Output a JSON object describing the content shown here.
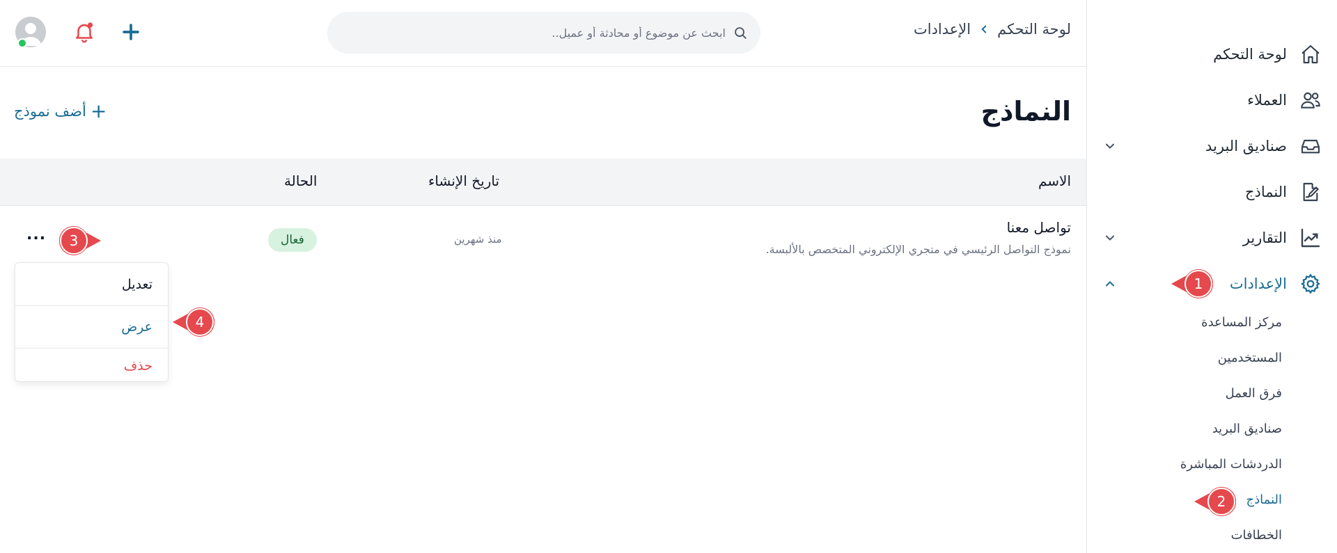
{
  "sidebar": {
    "items": [
      {
        "label": "لوحة التحكم",
        "icon": "home-icon"
      },
      {
        "label": "العملاء",
        "icon": "users-icon"
      },
      {
        "label": "صناديق البريد",
        "icon": "inbox-icon"
      },
      {
        "label": "النماذج",
        "icon": "form-edit-icon"
      },
      {
        "label": "التقارير",
        "icon": "chart-icon"
      },
      {
        "label": "الإعدادات",
        "icon": "gear-icon"
      }
    ],
    "settings_sub": [
      {
        "label": "مركز المساعدة"
      },
      {
        "label": "المستخدمين"
      },
      {
        "label": "فرق العمل"
      },
      {
        "label": "صناديق البريد"
      },
      {
        "label": "الدردشات المباشرة"
      },
      {
        "label": "النماذج"
      },
      {
        "label": "الخطافات"
      }
    ]
  },
  "header": {
    "breadcrumb": [
      "لوحة التحكم",
      "الإعدادات"
    ],
    "search_placeholder": "ابحث عن موضوع أو محادثة أو عميل.."
  },
  "page": {
    "title": "النماذج",
    "add_label": "أضف نموذج"
  },
  "table": {
    "headers": {
      "name": "الاسم",
      "created": "تاريخ الإنشاء",
      "status": "الحالة"
    },
    "row": {
      "title": "تواصل معنا",
      "description": "نموذج التواصل الرئيسي في متجري الإلكتروني المتخصص بالألبسة.",
      "created": "منذ شهرين",
      "status": "فعال",
      "more": "..."
    }
  },
  "menu": {
    "edit": "تعديل",
    "view": "عرض",
    "delete": "حذف"
  },
  "callouts": [
    "1",
    "2",
    "3",
    "4"
  ],
  "colors": {
    "accent": "#1a6c93",
    "callout": "#e5484d",
    "status_bg": "#d7f2df",
    "danger": "#e5484d"
  }
}
